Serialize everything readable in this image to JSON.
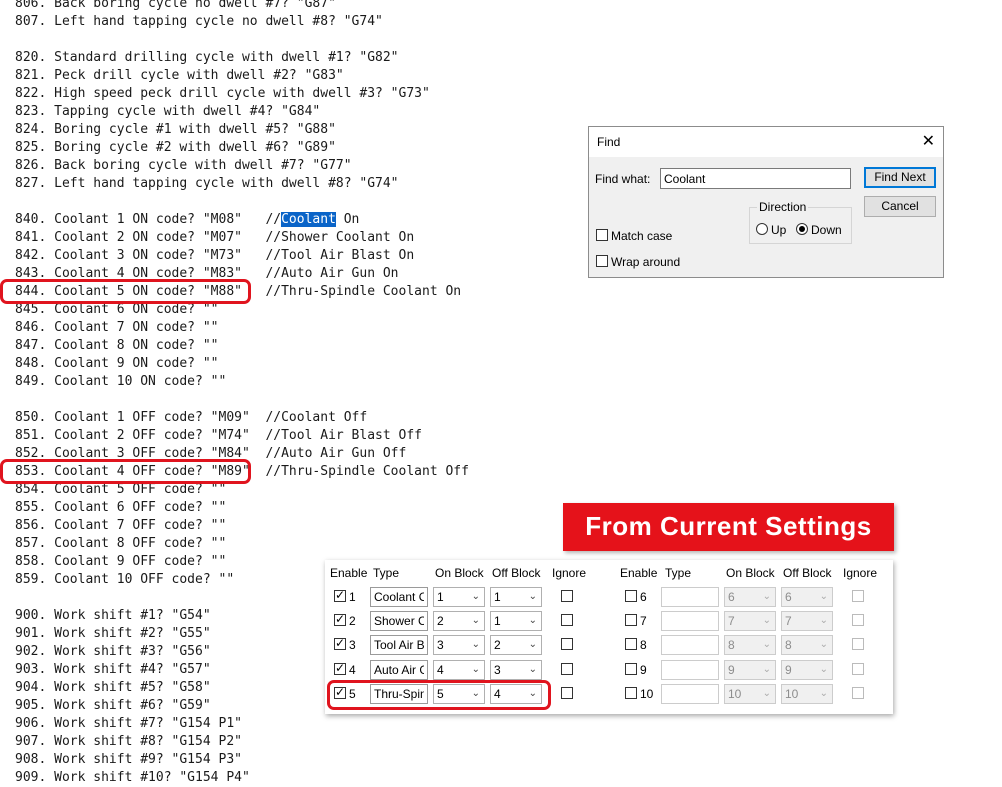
{
  "code_lines": [
    "806. Back boring cycle no dwell #7? \"G87\"",
    "807. Left hand tapping cycle no dwell #8? \"G74\"",
    "",
    "820. Standard drilling cycle with dwell #1? \"G82\"",
    "821. Peck drill cycle with dwell #2? \"G83\"",
    "822. High speed peck drill cycle with dwell #3? \"G73\"",
    "823. Tapping cycle with dwell #4? \"G84\"",
    "824. Boring cycle #1 with dwell #5? \"G88\"",
    "825. Boring cycle #2 with dwell #6? \"G89\"",
    "826. Back boring cycle with dwell #7? \"G77\"",
    "827. Left hand tapping cycle with dwell #8? \"G74\"",
    "",
    "840. Coolant 1 ON code? \"M08\"   //|Coolant| On",
    "841. Coolant 2 ON code? \"M07\"   //Shower Coolant On",
    "842. Coolant 3 ON code? \"M73\"   //Tool Air Blast On",
    "843. Coolant 4 ON code? \"M83\"   //Auto Air Gun On",
    "844. Coolant 5 ON code? \"M88\"   //Thru-Spindle Coolant On",
    "845. Coolant 6 ON code? \"\"",
    "846. Coolant 7 ON code? \"\"",
    "847. Coolant 8 ON code? \"\"",
    "848. Coolant 9 ON code? \"\"",
    "849. Coolant 10 ON code? \"\"",
    "",
    "850. Coolant 1 OFF code? \"M09\"  //Coolant Off",
    "851. Coolant 2 OFF code? \"M74\"  //Tool Air Blast Off",
    "852. Coolant 3 OFF code? \"M84\"  //Auto Air Gun Off",
    "853. Coolant 4 OFF code? \"M89\"  //Thru-Spindle Coolant Off",
    "854. Coolant 5 OFF code? \"\"",
    "855. Coolant 6 OFF code? \"\"",
    "856. Coolant 7 OFF code? \"\"",
    "857. Coolant 8 OFF code? \"\"",
    "858. Coolant 9 OFF code? \"\"",
    "859. Coolant 10 OFF code? \"\"",
    "",
    "900. Work shift #1? \"G54\"",
    "901. Work shift #2? \"G55\"",
    "902. Work shift #3? \"G56\"",
    "903. Work shift #4? \"G57\"",
    "904. Work shift #5? \"G58\"",
    "905. Work shift #6? \"G59\"",
    "906. Work shift #7? \"G154 P1\"",
    "907. Work shift #8? \"G154 P2\"",
    "908. Work shift #9? \"G154 P3\"",
    "909. Work shift #10? \"G154 P4\""
  ],
  "find_dialog": {
    "title": "Find",
    "close_glyph": "✕",
    "find_what_label": "Find what:",
    "find_what_value": "Coolant",
    "find_next_label": "Find Next",
    "cancel_label": "Cancel",
    "direction_label": "Direction",
    "up_label": "Up",
    "down_label": "Down",
    "direction_selected": "down",
    "match_case_label": "Match case",
    "wrap_around_label": "Wrap around"
  },
  "banner": {
    "text": "From Current Settings"
  },
  "settings": {
    "headers": {
      "enable": "Enable",
      "type": "Type",
      "on_block": "On Block",
      "off_block": "Off Block",
      "ignore": "Ignore"
    },
    "rows": [
      {
        "num": "1",
        "enabled": true,
        "type": "Coolant On",
        "on": "1",
        "off": "1",
        "ignore": false
      },
      {
        "num": "2",
        "enabled": true,
        "type": "Shower Co",
        "on": "2",
        "off": "1",
        "ignore": false
      },
      {
        "num": "3",
        "enabled": true,
        "type": "Tool Air Bla",
        "on": "3",
        "off": "2",
        "ignore": false
      },
      {
        "num": "4",
        "enabled": true,
        "type": "Auto Air Gu",
        "on": "4",
        "off": "3",
        "ignore": false
      },
      {
        "num": "5",
        "enabled": true,
        "type": "Thru-Spind",
        "on": "5",
        "off": "4",
        "ignore": false
      },
      {
        "num": "6",
        "enabled": false,
        "type": "",
        "on": "6",
        "off": "6",
        "ignore": false
      },
      {
        "num": "7",
        "enabled": false,
        "type": "",
        "on": "7",
        "off": "7",
        "ignore": false
      },
      {
        "num": "8",
        "enabled": false,
        "type": "",
        "on": "8",
        "off": "8",
        "ignore": false
      },
      {
        "num": "9",
        "enabled": false,
        "type": "",
        "on": "9",
        "off": "9",
        "ignore": false
      },
      {
        "num": "10",
        "enabled": false,
        "type": "",
        "on": "10",
        "off": "10",
        "ignore": false
      }
    ]
  },
  "colors": {
    "highlight": "#0a64c8",
    "accent_red": "#e5121a",
    "focus_blue": "#0078d7"
  }
}
